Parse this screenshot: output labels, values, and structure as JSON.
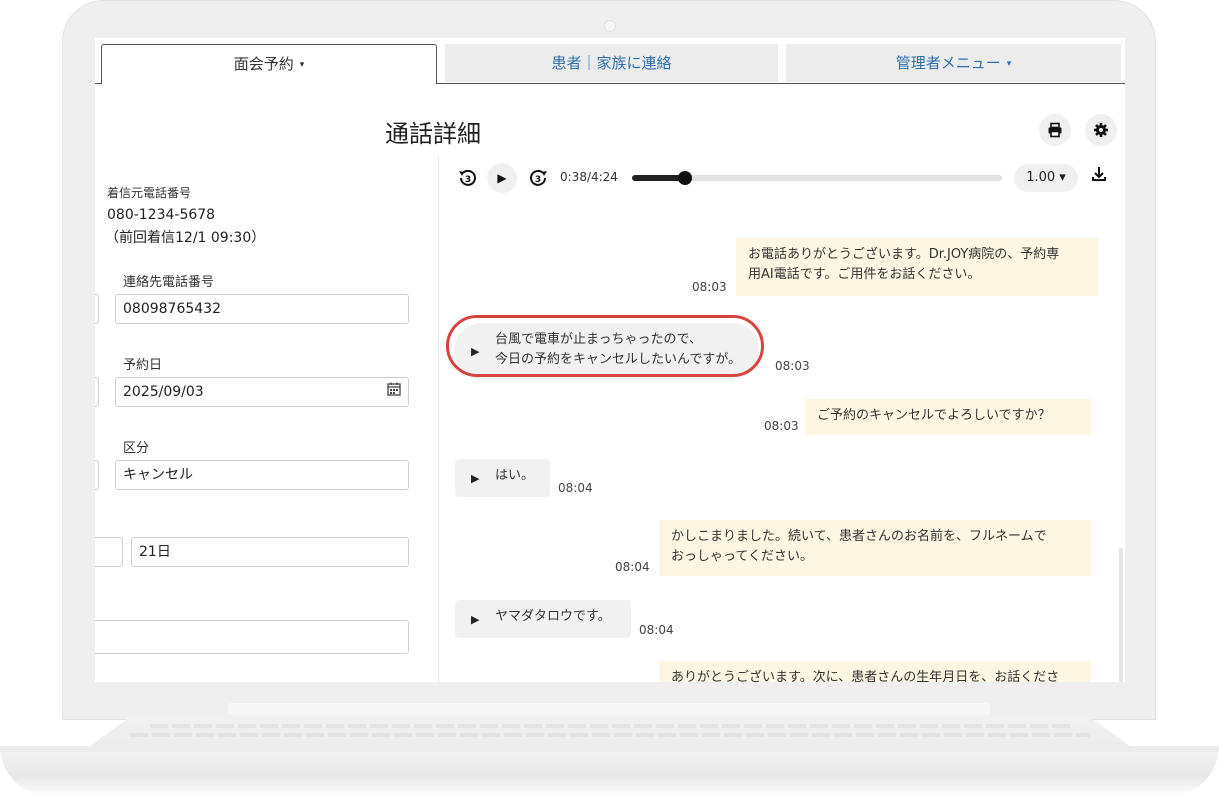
{
  "tabs": [
    {
      "label": "面会予約",
      "caret": "▾"
    },
    {
      "label": "患者｜家族に連絡"
    },
    {
      "label": "管理者メニュー",
      "caret": "▾"
    }
  ],
  "page": {
    "title": "通話詳細"
  },
  "icons": {
    "print": "print-icon",
    "settings": "gear-icon",
    "calendar": "calendar-icon",
    "download": "download-icon"
  },
  "form": {
    "caller_label": "着信元電話番号",
    "caller_number": "080-1234-5678",
    "caller_previous": "（前回着信12/1 09:30）",
    "contact_label": "連絡先電話番号",
    "contact_value": "08098765432",
    "date_label": "予約日",
    "date_value": "2025/09/03",
    "category_label": "区分",
    "category_value": "キャンセル",
    "day_value": "21日",
    "extra_value": ""
  },
  "player": {
    "rewind_label": "3",
    "forward_label": "3",
    "play_glyph": "▶",
    "current_time": "0:38",
    "total_time": "4:24",
    "time_display": "0:38/4:24",
    "progress": 0.144,
    "speed": "1.00 ▾"
  },
  "messages": [
    {
      "role": "ai",
      "text_line1": "お電話ありがとうございます。Dr.JOY病院の、予約専",
      "text_line2": "用AI電話です。ご用件をお話ください。",
      "time": "08:03"
    },
    {
      "role": "user",
      "text_line1": "台風で電車が止まっちゃったので、",
      "text_line2": "今日の予約をキャンセルしたいんですが。",
      "time": "08:03",
      "highlighted": true
    },
    {
      "role": "ai",
      "text_line1": "ご予約のキャンセルでよろしいですか？",
      "time": "08:03"
    },
    {
      "role": "user",
      "text_line1": "はい。",
      "time": "08:04"
    },
    {
      "role": "ai",
      "text_line1": "かしこまりました。続いて、患者さんのお名前を、フルネームで",
      "text_line2": "おっしゃってください。",
      "time": "08:04"
    },
    {
      "role": "user",
      "text_line1": "ヤマダタロウです。",
      "time": "08:04"
    },
    {
      "role": "ai",
      "text_line1": "ありがとうございます。次に、患者さんの生年月日を、お話くださ"
    }
  ],
  "colors": {
    "accent_blue": "#2f6fb0",
    "ai_bubble": "#fcf6e3",
    "user_bubble": "#f1f1f1",
    "highlight": "#d9433f"
  }
}
